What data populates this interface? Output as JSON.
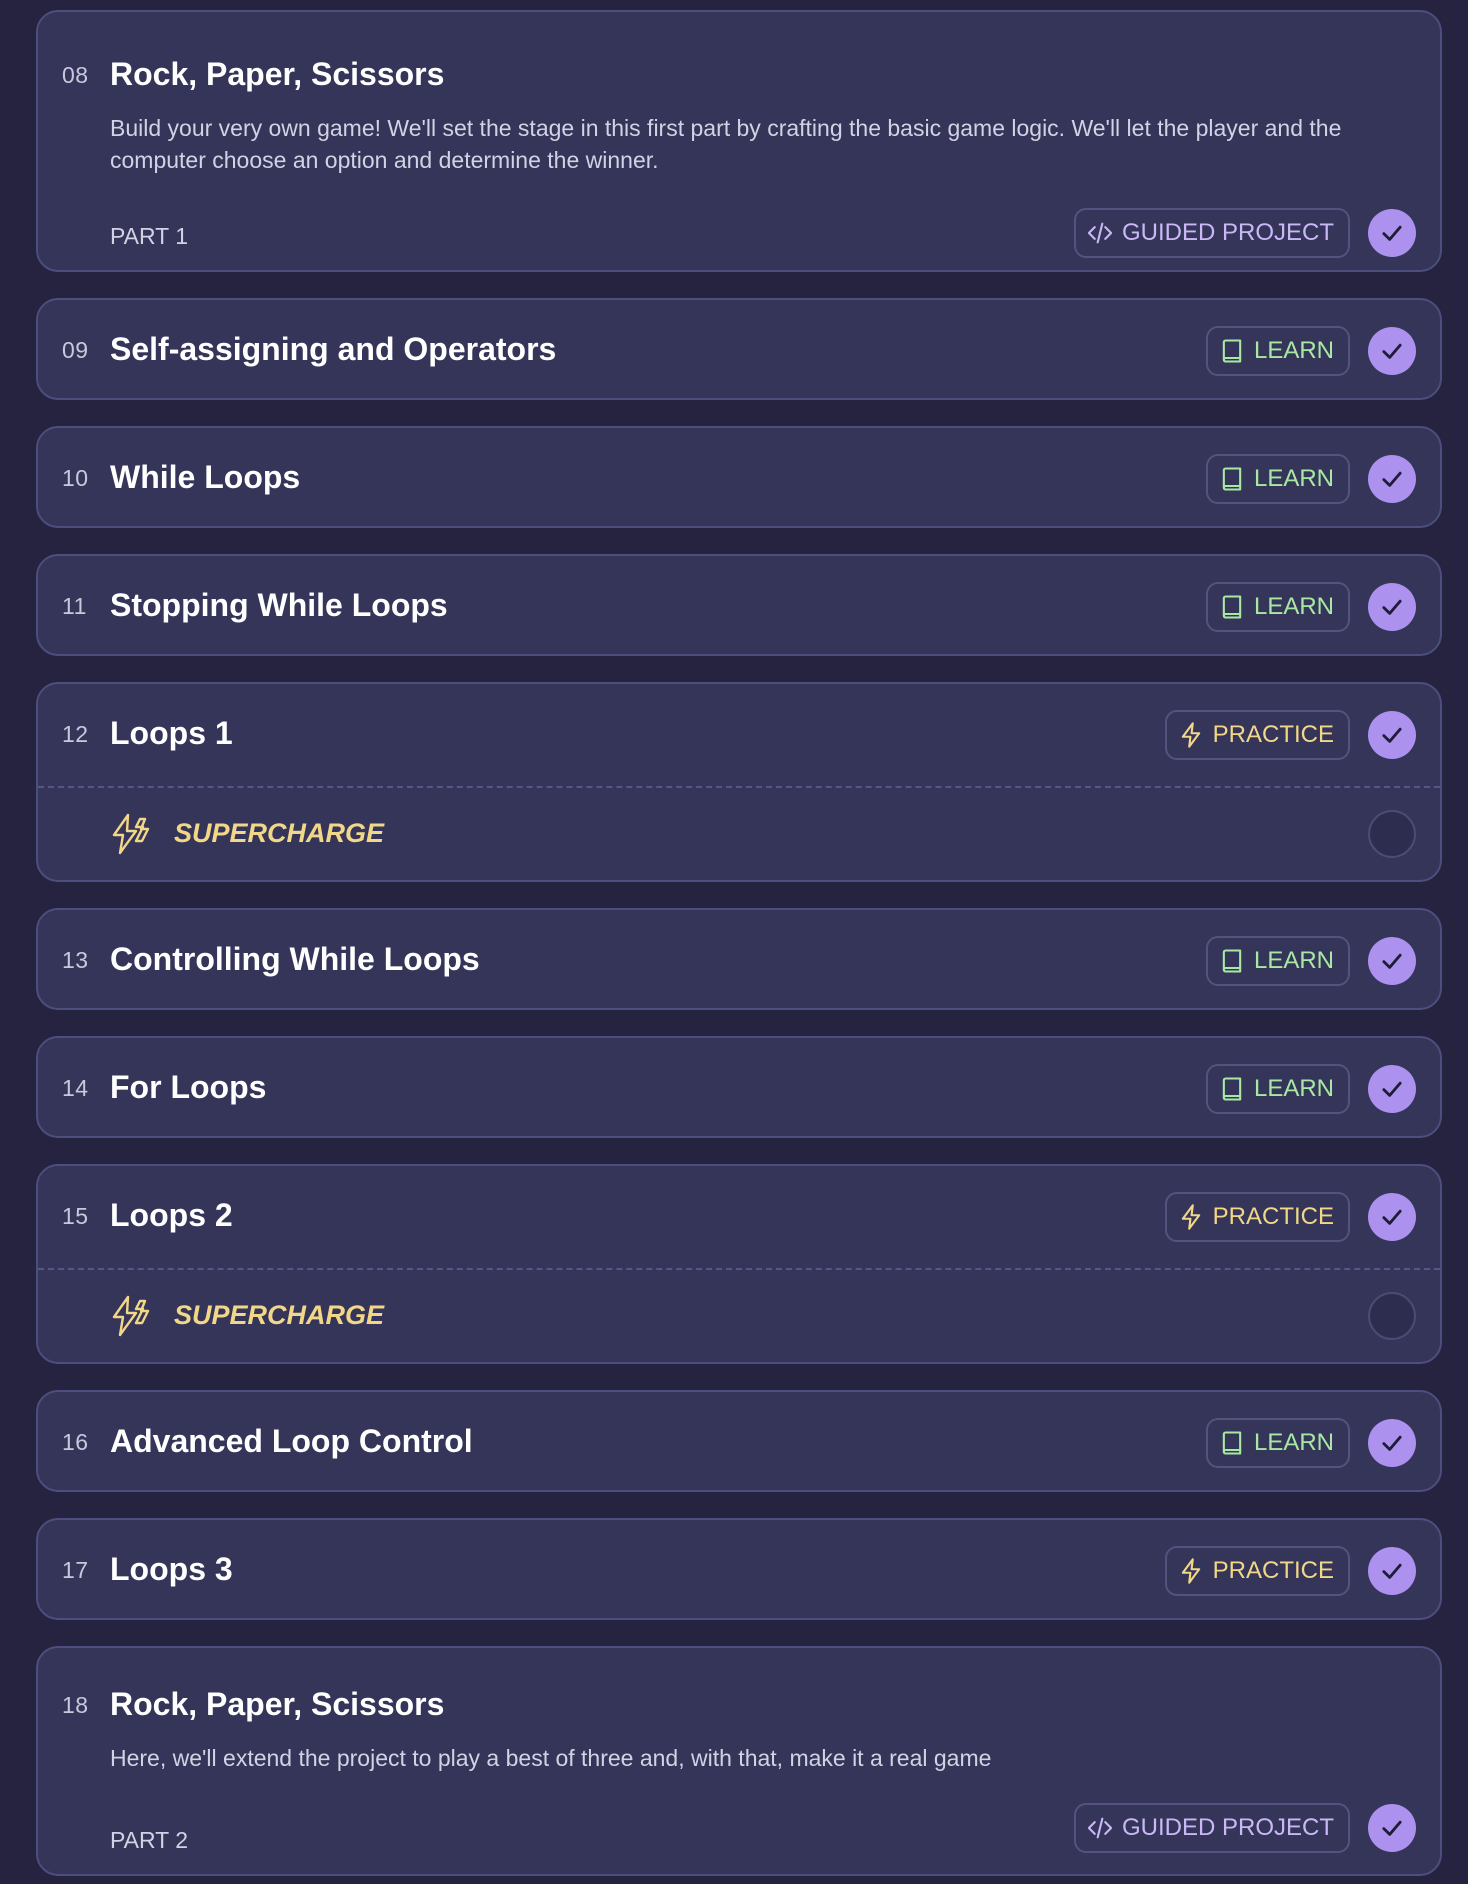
{
  "lessons": [
    {
      "number": "08",
      "title": "Rock, Paper, Scissors",
      "description": "Build your very own game! We'll set the stage in this first part by crafting the basic game logic. We'll let the player and the computer choose an option and determine the winner.",
      "part": "PART 1",
      "badge": "GUIDED PROJECT",
      "type": "guided",
      "icon": "code-icon",
      "completed": true
    },
    {
      "number": "09",
      "title": "Self-assigning and Operators",
      "badge": "LEARN",
      "type": "learn",
      "icon": "book-icon",
      "completed": true
    },
    {
      "number": "10",
      "title": "While Loops",
      "badge": "LEARN",
      "type": "learn",
      "icon": "book-icon",
      "completed": true
    },
    {
      "number": "11",
      "title": "Stopping While Loops",
      "badge": "LEARN",
      "type": "learn",
      "icon": "book-icon",
      "completed": true
    },
    {
      "number": "12",
      "title": "Loops 1",
      "badge": "PRACTICE",
      "type": "practice",
      "icon": "lightning-icon",
      "completed": true,
      "supercharge": {
        "label": "SUPERCHARGE",
        "icon": "double-lightning-icon",
        "completed": false
      }
    },
    {
      "number": "13",
      "title": "Controlling While Loops",
      "badge": "LEARN",
      "type": "learn",
      "icon": "book-icon",
      "completed": true
    },
    {
      "number": "14",
      "title": "For Loops",
      "badge": "LEARN",
      "type": "learn",
      "icon": "book-icon",
      "completed": true
    },
    {
      "number": "15",
      "title": "Loops 2",
      "badge": "PRACTICE",
      "type": "practice",
      "icon": "lightning-icon",
      "completed": true,
      "supercharge": {
        "label": "SUPERCHARGE",
        "icon": "double-lightning-icon",
        "completed": false
      }
    },
    {
      "number": "16",
      "title": "Advanced Loop Control",
      "badge": "LEARN",
      "type": "learn",
      "icon": "book-icon",
      "completed": true
    },
    {
      "number": "17",
      "title": "Loops 3",
      "badge": "PRACTICE",
      "type": "practice",
      "icon": "lightning-icon",
      "completed": true
    },
    {
      "number": "18",
      "title": "Rock, Paper, Scissors",
      "description": "Here, we'll extend the project to play a best of three and, with that, make it a real game",
      "part": "PART 2",
      "badge": "GUIDED PROJECT",
      "type": "guided",
      "icon": "code-icon",
      "completed": true
    }
  ],
  "colors": {
    "page_background": "#25233f",
    "card_background": "#343559",
    "card_border": "#4c4e7d",
    "check_fill": "#ad91ef",
    "learn": "#a9e7a4",
    "practice": "#f2d788",
    "guided": "#c9b8f5"
  }
}
